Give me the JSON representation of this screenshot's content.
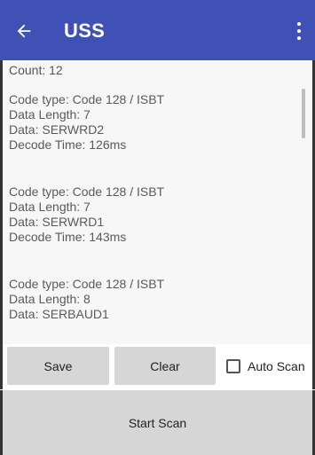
{
  "appbar": {
    "title": "USS",
    "back_icon": "arrow-back-icon",
    "menu_icon": "more-vert-icon",
    "color": "#3f51b5"
  },
  "results": {
    "count_label": "Count:",
    "count_value": "12",
    "entries": [
      [
        "Code type: Code 128 / ISBT",
        "Data Length: 7",
        "Data: SERWRD2",
        "Decode Time: 126ms"
      ],
      [
        "Code type: Code 128 / ISBT",
        "Data Length: 7",
        "Data: SERWRD1",
        "Decode Time: 143ms"
      ],
      [
        "Code type: Code 128 / ISBT",
        "Data Length: 8",
        "Data: SERBAUD1"
      ]
    ]
  },
  "controls": {
    "save_label": "Save",
    "clear_label": "Clear",
    "auto_scan_label": "Auto Scan",
    "auto_scan_checked": false,
    "start_scan_label": "Start Scan"
  }
}
